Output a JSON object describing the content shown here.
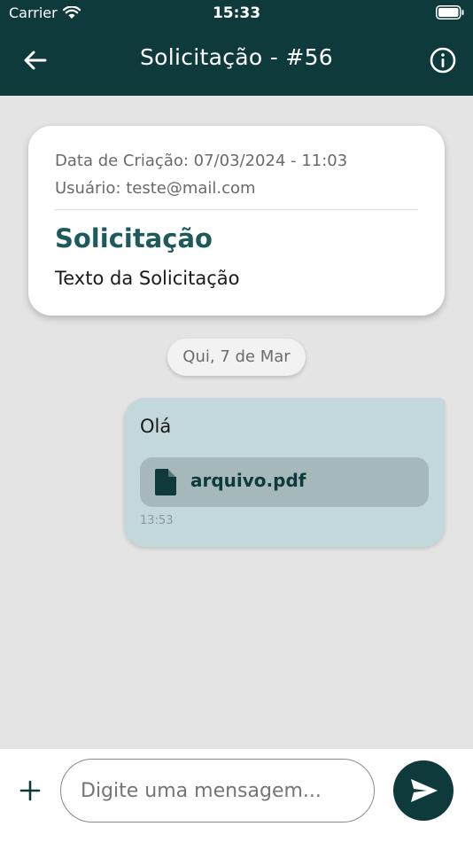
{
  "status_bar": {
    "carrier": "Carrier",
    "time": "15:33"
  },
  "header": {
    "title": "Solicitação - #56",
    "back_icon": "arrow-left-icon",
    "info_icon": "info-circle-icon"
  },
  "request_card": {
    "created_line": "Data de Criação: 07/03/2024 - 11:03",
    "user_line": "Usuário: teste@mail.com",
    "title": "Solicitação",
    "text": "Texto da Solicitação"
  },
  "date_chip": "Qui, 7 de Mar",
  "messages": [
    {
      "text": "Olá",
      "attachment": {
        "name": "arquivo.pdf",
        "icon": "file-icon"
      },
      "time": "13:53"
    }
  ],
  "composer": {
    "placeholder": "Digite uma mensagem...",
    "add_icon": "plus-icon",
    "send_icon": "send-icon"
  },
  "colors": {
    "header_bg": "#0f3a3c",
    "accent_text": "#1d5a5c",
    "bubble_bg": "#c3d8da",
    "attachment_bg": "#a5b8ba",
    "page_bg": "#e4e4e4"
  }
}
